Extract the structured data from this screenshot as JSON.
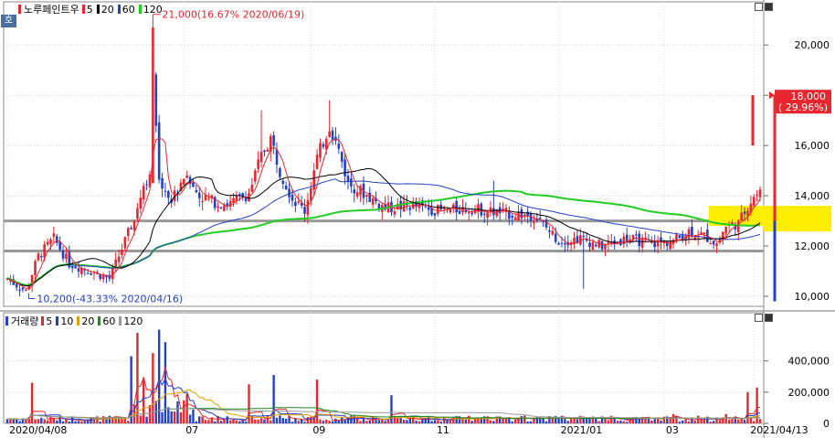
{
  "price_panel": {
    "legend": {
      "title": "노루페인트우",
      "ma_items": [
        {
          "label": "5",
          "color": "#e8262d"
        },
        {
          "label": "20",
          "color": "#000000"
        },
        {
          "label": "60",
          "color": "#2440c8"
        },
        {
          "label": "120",
          "color": "#22cc22"
        }
      ]
    },
    "tag": "호"
  },
  "volume_panel": {
    "legend": {
      "title": "거래량",
      "ma_items": [
        {
          "label": "5",
          "color": "#e8262d"
        },
        {
          "label": "10",
          "color": "#2440c8"
        },
        {
          "label": "20",
          "color": "#e0a000"
        },
        {
          "label": "60",
          "color": "#1c8c1c"
        },
        {
          "label": "120",
          "color": "#999999"
        }
      ]
    }
  },
  "chart_data": {
    "type": "candlestick",
    "price_axis": {
      "ylim": [
        9600,
        21500
      ],
      "ticks": [
        10000,
        12000,
        14000,
        16000,
        18000,
        20000
      ],
      "tick_labels": [
        "10,000",
        "12,000",
        "14,000",
        "16,000",
        "18,000",
        "20,000"
      ]
    },
    "volume_axis": {
      "ylim": [
        0,
        650000
      ],
      "ticks": [
        0,
        200000,
        400000
      ],
      "tick_labels": [
        "0",
        "200,000",
        "400,000"
      ]
    },
    "x_labels": [
      {
        "label": "2020/04/08",
        "index": 0
      },
      {
        "label": "07",
        "index": 57
      },
      {
        "label": "09",
        "index": 98
      },
      {
        "label": "11",
        "index": 138
      },
      {
        "label": "2021/01",
        "index": 178
      },
      {
        "label": "03",
        "index": 212
      },
      {
        "label": "2021/04/13",
        "index": 241
      }
    ],
    "current_price": {
      "value": 18000,
      "label": "18,000",
      "pct": "( 29.96%)",
      "limit_low": 16000
    },
    "annotations": {
      "high": {
        "label": "21,000(16.67% 2020/06/19)",
        "value": 21000,
        "index": 47
      },
      "low": {
        "label": "10,200(-43.33% 2020/04/16)",
        "value": 10200,
        "index": 6
      }
    },
    "support_lines": [
      13000,
      11800
    ],
    "highlight_zone": {
      "low": 12800,
      "high": 13600,
      "from_index": 227
    },
    "lower_indicator": {
      "value": 9800,
      "top": 13000
    },
    "series": {
      "candles": "OHLC generated from anchor closes",
      "volume": "daily shares"
    }
  }
}
